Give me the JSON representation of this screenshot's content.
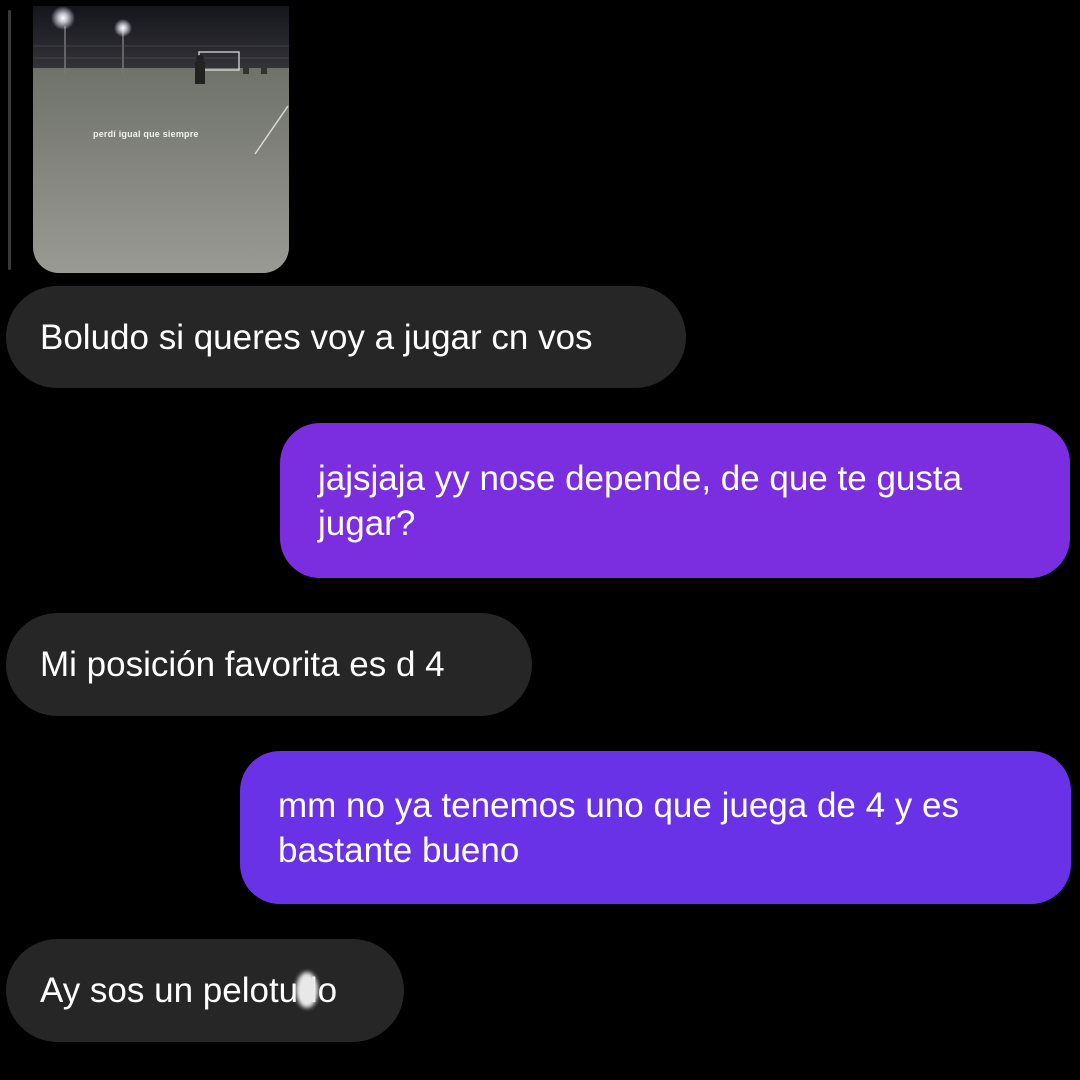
{
  "story_reply": {
    "caption": "perdí igual que siempre"
  },
  "messages": [
    {
      "direction": "received",
      "text": "Boludo si queres voy a jugar cn vos"
    },
    {
      "direction": "sent",
      "text": "jajsjaja yy nose depende, de que te gusta jugar?"
    },
    {
      "direction": "received",
      "text": "Mi posición favorita es d 4"
    },
    {
      "direction": "sent",
      "text": "mm no ya tenemos uno que juega de 4 y es bastante bueno"
    },
    {
      "direction": "received",
      "text": "Ay sos un pelotudo"
    }
  ],
  "colors": {
    "background": "#000000",
    "received_bubble": "#262626",
    "sent_bubble_top": "#7b2ee0",
    "sent_bubble_bottom": "#6a32e6",
    "text": "#ffffff"
  }
}
